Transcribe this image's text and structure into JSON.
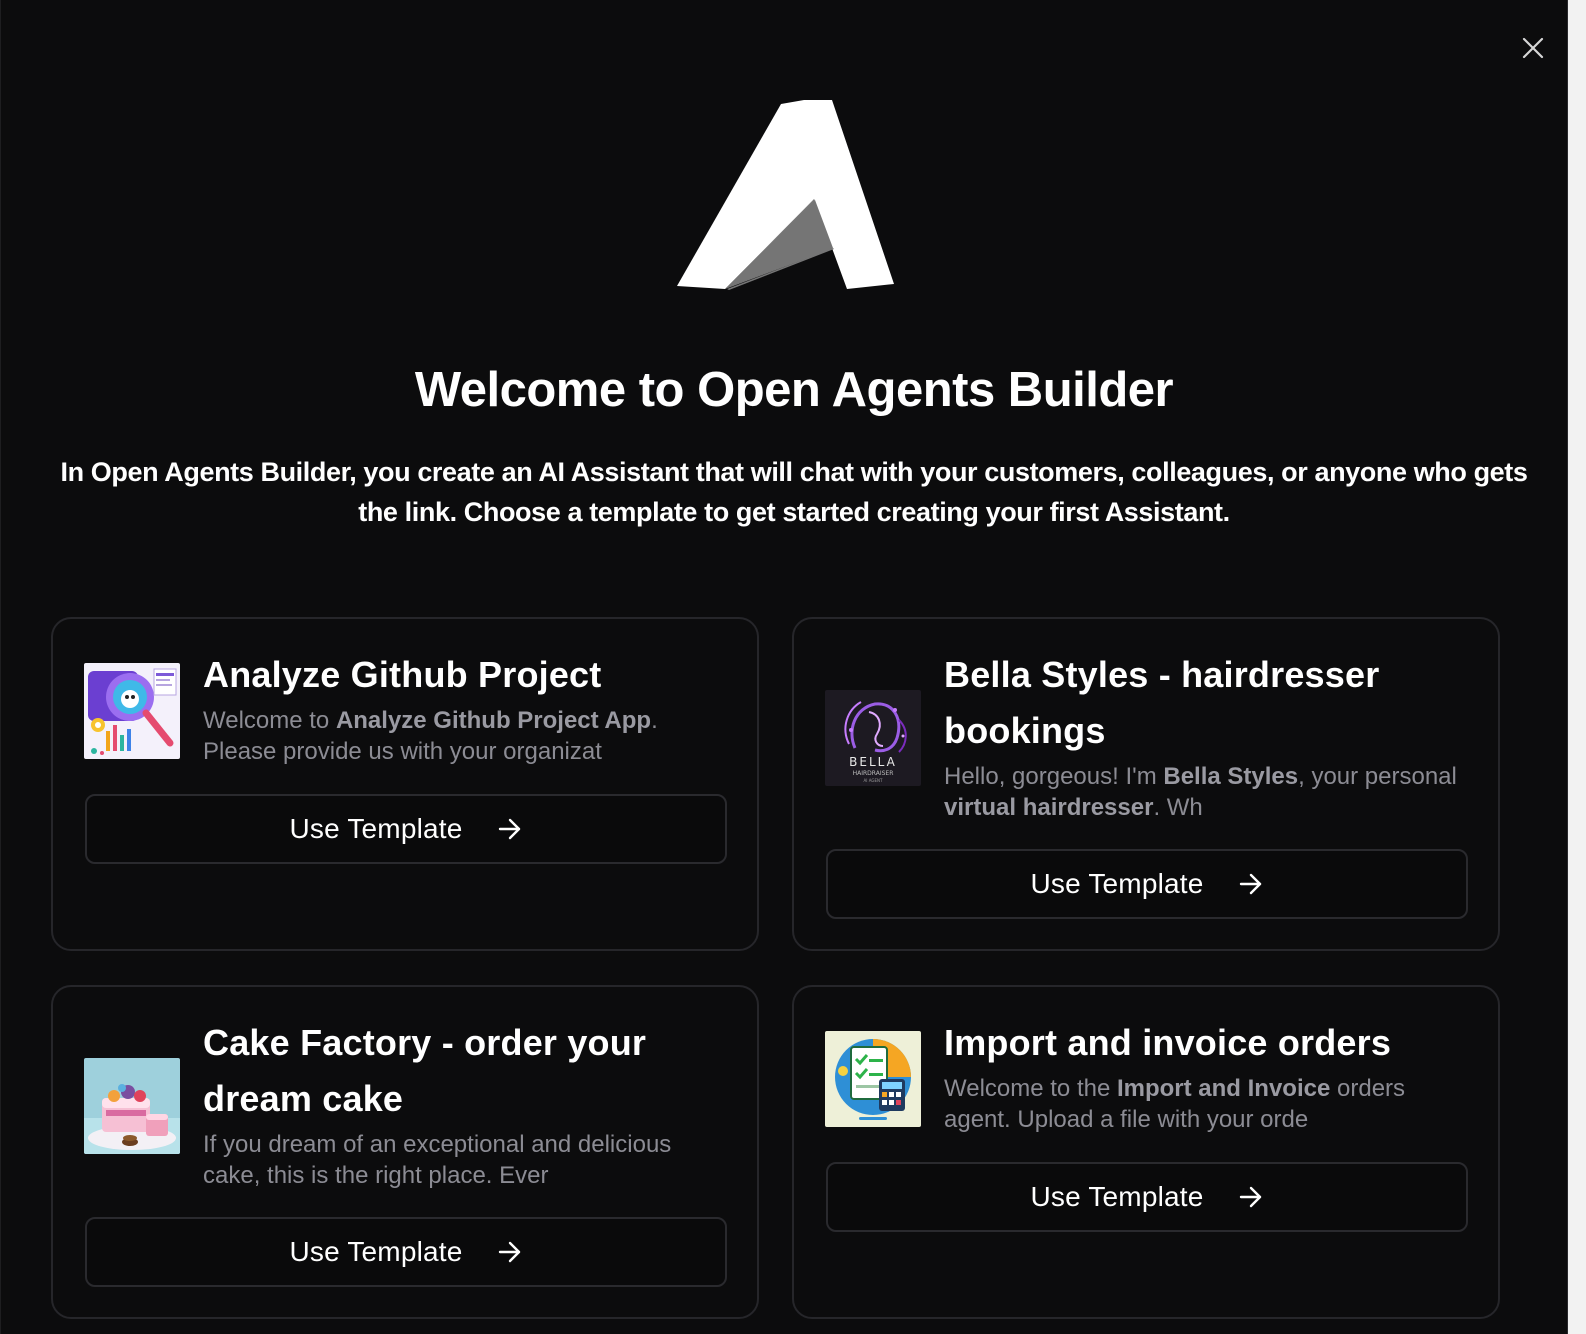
{
  "modal": {
    "title": "Welcome to Open Agents Builder",
    "intro": "In Open Agents Builder, you create an AI Assistant that will chat with your customers, colleagues, or anyone who gets the link. Choose a template to get started creating your first Assistant.",
    "close_icon": "close-icon",
    "logo_icon": "open-agents-builder-logo"
  },
  "templates": [
    {
      "title": "Analyze Github Project",
      "desc_parts": [
        "Welcome to ",
        "Analyze Github Project App",
        ". Please provide us with your organizat"
      ],
      "button_label": "Use Template",
      "icon": "github-analyze-thumbnail"
    },
    {
      "title": "Bella Styles - hairdresser bookings",
      "desc_parts": [
        "Hello, gorgeous! I'm ",
        "Bella Styles",
        ", your personal ",
        "virtual hairdresser",
        ". Wh"
      ],
      "button_label": "Use Template",
      "icon": "bella-hairdresser-thumbnail",
      "thumb_text": [
        "BELLA",
        "HAIRDRAISER",
        "AI AGENT"
      ]
    },
    {
      "title": "Cake Factory - order your dream cake",
      "desc_parts": [
        "If you dream of an exceptional and delicious cake, this is the right place. Ever"
      ],
      "button_label": "Use Template",
      "icon": "cake-thumbnail"
    },
    {
      "title": "Import and invoice orders",
      "desc_parts": [
        "Welcome to the ",
        "Import and Invoice",
        " orders agent. Upload a file with your orde"
      ],
      "button_label": "Use Template",
      "icon": "invoice-thumbnail"
    }
  ],
  "colors": {
    "background": "#0c0c0d",
    "card_border": "#26262a",
    "muted_text": "#8c8c94"
  }
}
